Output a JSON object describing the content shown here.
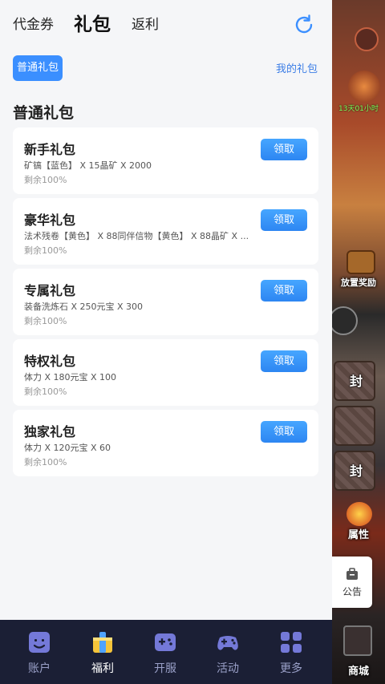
{
  "header": {
    "tabs": [
      {
        "label": "代金券"
      },
      {
        "label": "礼包"
      },
      {
        "label": "返利"
      }
    ]
  },
  "filter": {
    "chip_label": "普通礼包",
    "my_gifts_label": "我的礼包"
  },
  "section_title": "普通礼包",
  "packs": [
    {
      "name": "新手礼包",
      "desc": "矿镐【蓝色】 X 15晶矿 X 2000",
      "remain": "剩余100%",
      "button": "领取"
    },
    {
      "name": "豪华礼包",
      "desc": "法术残卷【黄色】 X 88同伴信物【黄色】 X 88晶矿 X ...",
      "remain": "剩余100%",
      "button": "领取"
    },
    {
      "name": "专属礼包",
      "desc": "装备洗炼石 X 250元宝 X 300",
      "remain": "剩余100%",
      "button": "领取"
    },
    {
      "name": "特权礼包",
      "desc": "体力 X 180元宝 X 100",
      "remain": "剩余100%",
      "button": "领取"
    },
    {
      "name": "独家礼包",
      "desc": "体力 X 120元宝 X 60",
      "remain": "剩余100%",
      "button": "领取"
    }
  ],
  "announce_label": "公告",
  "game": {
    "seal_1": "封",
    "seal_2": "封",
    "label_reward": "放置奖励",
    "label_attr": "属性",
    "label_shop": "商城",
    "label_sub": "13天01小时"
  },
  "nav": [
    {
      "label": "账户",
      "icon": "account-icon"
    },
    {
      "label": "福利",
      "icon": "gift-icon"
    },
    {
      "label": "开服",
      "icon": "server-icon"
    },
    {
      "label": "活动",
      "icon": "gamepad-icon"
    },
    {
      "label": "更多",
      "icon": "grid-icon"
    }
  ],
  "colors": {
    "accent": "#3b8fff",
    "nav_bg": "#1b1f35",
    "nav_icon": "#7479d8",
    "active_icon": "#f5c43a"
  }
}
